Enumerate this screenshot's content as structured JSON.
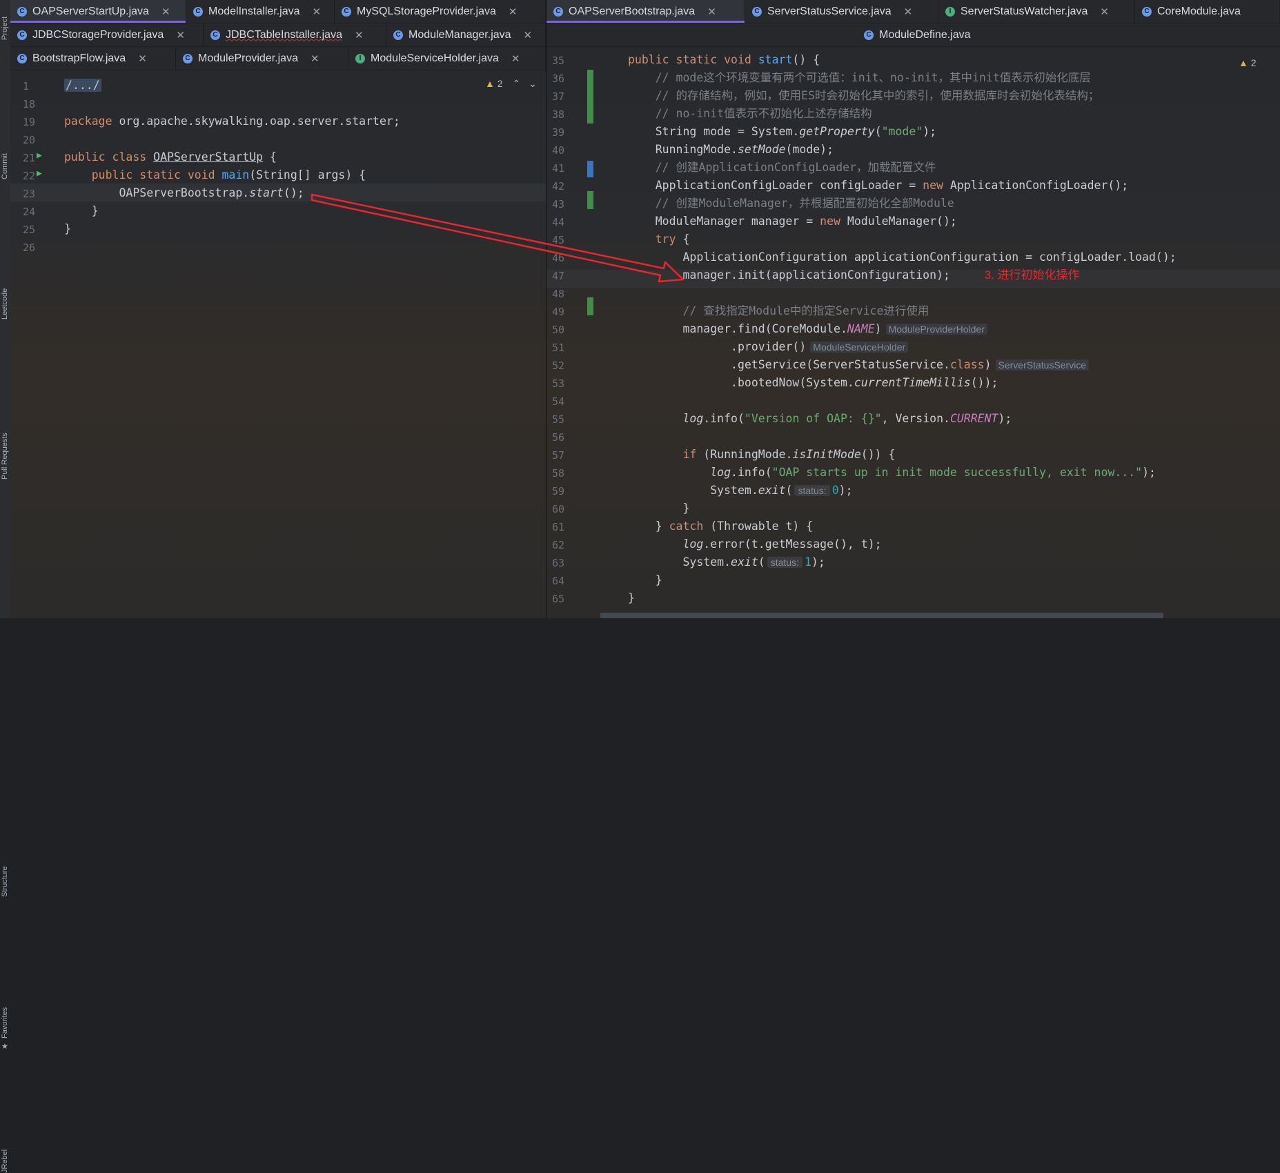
{
  "toolstrip": {
    "items": [
      "Project",
      "Commit",
      "Leetcode",
      "Pull Requests",
      "Structure",
      "Favorites",
      "JRebel"
    ]
  },
  "left": {
    "tabs_row1": [
      {
        "label": "OAPServerStartUp.java",
        "kind": "c",
        "active": true
      },
      {
        "label": "ModelInstaller.java",
        "kind": "c"
      },
      {
        "label": "MySQLStorageProvider.java",
        "kind": "c"
      }
    ],
    "tabs_row2": [
      {
        "label": "JDBCStorageProvider.java",
        "kind": "c"
      },
      {
        "label": "JDBCTableInstaller.java",
        "kind": "c"
      },
      {
        "label": "ModuleManager.java",
        "kind": "c"
      }
    ],
    "tabs_row3": [
      {
        "label": "BootstrapFlow.java",
        "kind": "c"
      },
      {
        "label": "ModuleProvider.java",
        "kind": "c"
      },
      {
        "label": "ModuleServiceHolder.java",
        "kind": "i"
      }
    ],
    "warnings": "2",
    "line_numbers": [
      "1",
      "18",
      "19",
      "20",
      "21",
      "22",
      "23",
      "24",
      "25",
      "26"
    ],
    "code": {
      "l1": "/.../",
      "l19_kw": "package",
      "l19_rest": " org.apache.skywalking.oap.server.starter;",
      "l21_kw": "public class",
      "l21_name": "OAPServerStartUp",
      "l21_rest": " {",
      "l22_kw": "public static void",
      "l22_fn": "main",
      "l22_rest": "(String[] args) {",
      "l23_obj": "OAPServerBootstrap.",
      "l23_call": "start",
      "l23_rest": "();",
      "l24": "}",
      "l25": "}"
    }
  },
  "right": {
    "tabs_row1": [
      {
        "label": "OAPServerBootstrap.java",
        "kind": "c",
        "active": true
      },
      {
        "label": "ServerStatusService.java",
        "kind": "c"
      },
      {
        "label": "ServerStatusWatcher.java",
        "kind": "i"
      },
      {
        "label": "CoreModule.java",
        "kind": "c"
      }
    ],
    "tabs_row2": [
      {
        "label": "ModuleDefine.java",
        "kind": "c"
      }
    ],
    "warnings": "2",
    "line_numbers": [
      "35",
      "36",
      "37",
      "38",
      "39",
      "40",
      "41",
      "42",
      "43",
      "44",
      "45",
      "46",
      "47",
      "48",
      "49",
      "50",
      "51",
      "52",
      "53",
      "54",
      "55",
      "56",
      "57",
      "58",
      "59",
      "60",
      "61",
      "62",
      "63",
      "64",
      "65"
    ],
    "code": {
      "l35": "public static void start() {",
      "l36": "// mode这个环境变量有两个可选值：init、no-init，其中init值表示初始化底层",
      "l37": "// 的存储结构，例如，使用ES时会初始化其中的索引，使用数据库时会初始化表结构；",
      "l38": "// no-init值表示不初始化上述存储结构",
      "l39a": "String mode = System.",
      "l39b": "getProperty",
      "l39c": "(",
      "l39d": "\"mode\"",
      "l39e": ");",
      "l40a": "RunningMode.",
      "l40b": "setMode",
      "l40c": "(mode);",
      "l41": "// 创建ApplicationConfigLoader，加载配置文件",
      "l42a": "ApplicationConfigLoader configLoader = ",
      "l42b": "new",
      "l42c": " ApplicationConfigLoader();",
      "l43": "// 创建ModuleManager，并根据配置初始化全部Module",
      "l44a": "ModuleManager manager = ",
      "l44b": "new",
      "l44c": " ModuleManager();",
      "l45a": "try",
      "l45b": " {",
      "l46": "ApplicationConfiguration applicationConfiguration = configLoader.load();",
      "l47": "manager.init(applicationConfiguration);",
      "l47_annotation": "3. 进行初始化操作",
      "l49": "// 查找指定Module中的指定Service进行使用",
      "l50a": "manager.find(CoreModule.",
      "l50b": "NAME",
      "l50c": ")",
      "l50_hint": "ModuleProviderHolder",
      "l51a": ".provider()",
      "l51_hint": "ModuleServiceHolder",
      "l52a": ".getService(ServerStatusService.",
      "l52b": "class",
      "l52c": ")",
      "l52_hint": "ServerStatusService",
      "l53a": ".bootedNow(System.",
      "l53b": "currentTimeMillis",
      "l53c": "());",
      "l55a": "log",
      "l55b": ".info(",
      "l55c": "\"Version of OAP: {}\"",
      "l55d": ", Version.",
      "l55e": "CURRENT",
      "l55f": ");",
      "l57a": "if",
      "l57b": " (RunningMode.",
      "l57c": "isInitMode",
      "l57d": "()) {",
      "l58a": "log",
      "l58b": ".info(",
      "l58c": "\"OAP starts up in init mode successfully, exit now...\"",
      "l58d": ");",
      "l59a": "System.",
      "l59b": "exit",
      "l59c": "(",
      "l59_hint": "status:",
      "l59d": "0",
      "l59e": ");",
      "l60": "}",
      "l61a": "} ",
      "l61b": "catch",
      "l61c": " (Throwable t) {",
      "l62a": "log",
      "l62b": ".error(t.getMessage(), t);",
      "l63a": "System.",
      "l63b": "exit",
      "l63c": "(",
      "l63_hint": "status:",
      "l63d": "1",
      "l63e": ");",
      "l64": "}",
      "l65": "}"
    }
  },
  "colors": {
    "keyword": "#cf8e6d",
    "function": "#56a8f5",
    "string": "#6aab73",
    "comment": "#7a7e85",
    "annotation_red": "#e8262b",
    "active_tab_underline": "#7b68c8"
  }
}
